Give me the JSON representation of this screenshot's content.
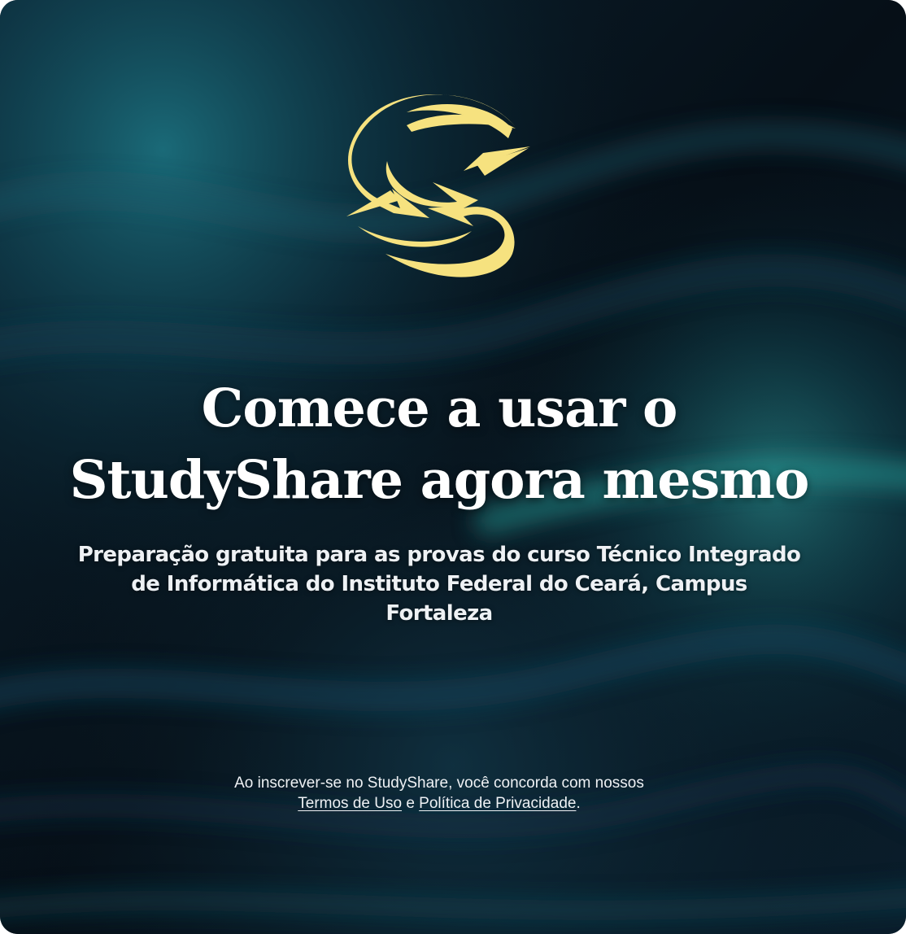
{
  "brand": {
    "logo_icon": "studyshare-logo-icon",
    "accent_color": "#f6e27f"
  },
  "hero": {
    "title_line1": "Comece a usar o",
    "title_line2": "StudyShare agora mesmo",
    "subtitle": "Preparação gratuita para as provas do curso Técnico Integrado de Informática do Instituto Federal do Ceará, Campus Fortaleza"
  },
  "legal": {
    "prefix": "Ao inscrever-se no StudyShare, você concorda com nossos",
    "terms_link": "Termos de Uso",
    "conjunction": "e",
    "privacy_link": "Política de Privacidade",
    "suffix": "."
  },
  "colors": {
    "background": "#07121b",
    "teal_glow": "#1a6a78",
    "text": "#ffffff"
  }
}
